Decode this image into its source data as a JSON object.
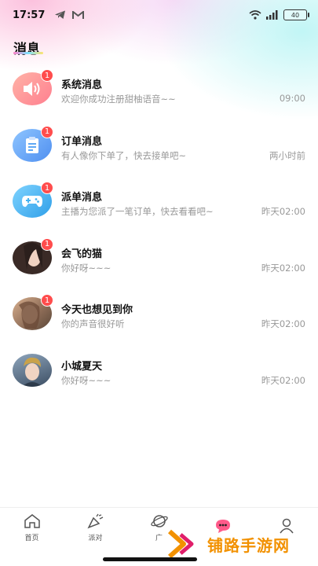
{
  "status_bar": {
    "time": "17:57",
    "battery": "40"
  },
  "header": {
    "title": "消息"
  },
  "messages": [
    {
      "name": "系统消息",
      "preview": "欢迎你成功注册甜柚语音~~",
      "time": "09:00",
      "badge": "1",
      "icon": "speaker-icon",
      "color": "#ff8a8a"
    },
    {
      "name": "订单消息",
      "preview": "有人像你下单了，快去接单吧~",
      "time": "两小时前",
      "badge": "1",
      "icon": "clipboard-icon",
      "color": "#5fa8f5"
    },
    {
      "name": "派单消息",
      "preview": "主播为您派了一笔订单，快去看看吧~",
      "time": "昨天02:00",
      "badge": "1",
      "icon": "gamepad-icon",
      "color": "#48b4f2"
    },
    {
      "name": "会飞的猫",
      "preview": "你好呀~~~",
      "time": "昨天02:00",
      "badge": "1",
      "icon": "user-photo",
      "color": "#6b5650"
    },
    {
      "name": "今天也想见到你",
      "preview": "你的声音很好听",
      "time": "昨天02:00",
      "badge": "1",
      "icon": "user-photo",
      "color": "#b98a6e"
    },
    {
      "name": "小城夏天",
      "preview": "你好呀~~~",
      "time": "昨天02:00",
      "badge": "",
      "icon": "user-photo",
      "color": "#4a6078"
    }
  ],
  "tab_bar": {
    "tabs": [
      {
        "label": "首页",
        "icon": "home-icon"
      },
      {
        "label": "派对",
        "icon": "party-icon"
      },
      {
        "label": "广",
        "icon": "planet-icon"
      },
      {
        "label": "",
        "icon": "chat-icon"
      },
      {
        "label": "",
        "icon": "profile-icon"
      }
    ]
  },
  "watermark": {
    "text": "铺路手游网"
  },
  "colors": {
    "accent": "#ff4d4d",
    "watermark": "#f29100"
  }
}
